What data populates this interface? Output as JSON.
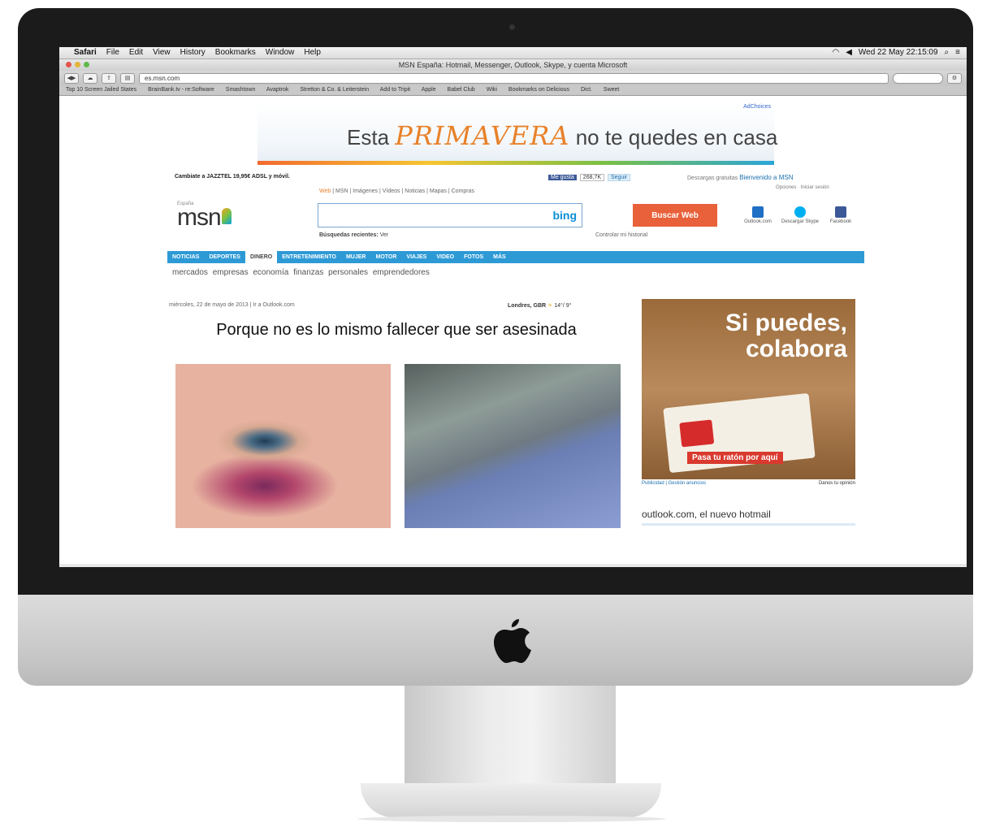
{
  "menubar": {
    "app": "Safari",
    "items": [
      "File",
      "Edit",
      "View",
      "History",
      "Bookmarks",
      "Window",
      "Help"
    ],
    "clock": "Wed 22 May  22:15:09"
  },
  "window": {
    "title": "MSN España: Hotmail, Messenger, Outlook, Skype, y cuenta Microsoft",
    "url": "es.msn.com"
  },
  "bookmarks": [
    "Top 10 Screen Jailed States",
    "BrainBank.tv - re:Software",
    "Smashtown",
    "Avaptrok",
    "Stretton & Co. & Leiterstein",
    "Add to Tripit",
    "Apple",
    "Babel Club",
    "Wiki",
    "Bookmarks on Delicious",
    "Dict.",
    "Sweet"
  ],
  "top_ad": {
    "adchoices": "AdChoices",
    "pre": "Esta",
    "highlight": "PRIMAVERA",
    "post": "no te quedes en casa"
  },
  "header": {
    "promo": "Cambiate a JAZZTEL 19,95€ ADSL y móvil.",
    "fb_label": "Me gusta",
    "fb_count": "268,7K",
    "tw_label": "Seguir",
    "downloads": "Descargas gratuitas",
    "welcome": "Bienvenido a MSN",
    "options": "Opciones · Iniciar sesión",
    "links": [
      "Web",
      "MSN",
      "Imágenes",
      "Vídeos",
      "Noticias",
      "Mapas",
      "Compras"
    ],
    "logo_small": "España",
    "logo": "msn",
    "search_engine": "bing",
    "search_button": "Buscar Web",
    "recent_label": "Búsquedas recientes:",
    "recent_value": "Ver",
    "history": "Controlar mi historial",
    "services": [
      {
        "label": "Outlook.com",
        "color": "#1f6fc4"
      },
      {
        "label": "Descargar Skype",
        "color": "#00aff0"
      },
      {
        "label": "Facebook",
        "color": "#3b5998"
      }
    ]
  },
  "categories": [
    "NOTICIAS",
    "DEPORTES",
    "DINERO",
    "ENTRETENIMIENTO",
    "MUJER",
    "MOTOR",
    "VIAJES",
    "VIDEO",
    "FOTOS",
    "MÁS"
  ],
  "selected_category": "DINERO",
  "subnav": [
    "mercados",
    "empresas",
    "economía",
    "finanzas personales",
    "emprendedores"
  ],
  "article": {
    "date": "miércoles, 22 de mayo de 2013 | Ir a Outlook.com",
    "location": "Londres, GBR",
    "temp": "14°/ 9°",
    "headline": "Porque no es lo mismo fallecer que ser asesinada"
  },
  "side_ad": {
    "title": "Si puedes, colabora",
    "cta": "Pasa tu ratón por aquí",
    "footer_left": "Publicidad | Gestión anuncios",
    "footer_right": "Danos tu opinión"
  },
  "outlook_promo": "outlook.com, el nuevo hotmail"
}
